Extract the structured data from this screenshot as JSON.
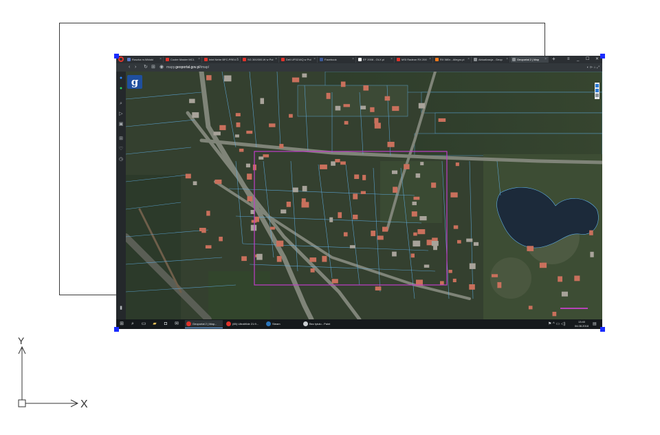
{
  "browser": {
    "tabs": [
      {
        "label": "Ruszka m.Widoki",
        "fav": "#5a77c7"
      },
      {
        "label": "Cooler Master MC1",
        "fav": "#e0332b"
      },
      {
        "label": "Intel Nehe BFC-PRE4 D",
        "fav": "#e0332b"
      },
      {
        "label": "SG 300/300-W w Poł",
        "fav": "#e0332b"
      },
      {
        "label": "Dell UP3216Q w Poł",
        "fav": "#e0332b"
      },
      {
        "label": "Facebook",
        "fav": "#3b5998"
      },
      {
        "label": "EF 2008 - OLX.pl",
        "fav": "#ffffff"
      },
      {
        "label": "MSI Radeon RX 200",
        "fav": "#e0332b"
      },
      {
        "label": "RX 580x - Allegro.pl",
        "fav": "#ff7a1a"
      },
      {
        "label": "Aktualizacja - Geop",
        "fav": "#8a8f93"
      },
      {
        "label": "Geoportal 2 | Map",
        "fav": "#8a8f93",
        "active": true
      }
    ],
    "url_prefix": "mapy.",
    "url_domain": "geoportal.gov.pl",
    "url_suffix": "/imap/",
    "window_controls": [
      "≡",
      "_",
      "☐",
      "✕"
    ]
  },
  "map": {
    "logo_letter": "g",
    "accent": "#c03cc9",
    "parcel_line_color": "#5fb0e8"
  },
  "sidebar_icons": [
    "messenger-icon",
    "whatsapp-icon",
    "search-icon",
    "send-icon",
    "camera-icon",
    "grid-icon",
    "heart-icon",
    "history-icon"
  ],
  "taskbar": {
    "apps": [
      {
        "label": "Geoportal 2 | Map...",
        "color": "#e0332b",
        "active": true
      },
      {
        "label": "(65) UltraWide 21:9...",
        "color": "#e0332b",
        "active": false
      },
      {
        "label": "Steam",
        "color": "#2a75bb",
        "active": false
      },
      {
        "label": "Bez tytułu - Paint",
        "color": "#c9cdd1",
        "active": false
      }
    ],
    "time": "13:40",
    "date": "04.08.2018"
  },
  "ucs": {
    "x_label": "X",
    "y_label": "Y"
  }
}
